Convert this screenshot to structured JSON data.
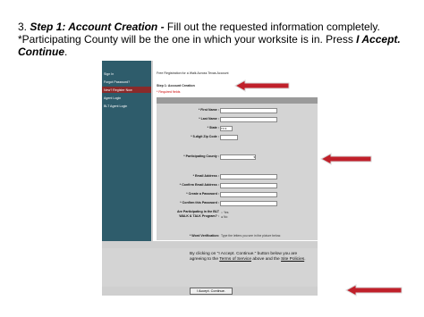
{
  "instruction": {
    "number": "3.",
    "step": "Step 1: Account Creation -",
    "text1": " Fill out the requested information completely. *Participating County will be the one in which your worksite is in.  Press ",
    "action": "I Accept. Continue",
    "end": "."
  },
  "sidebar": {
    "items": [
      "Sign In",
      "Forgot Password?",
      "New? Register Now",
      "Agent Login",
      "BLT Agent Login"
    ]
  },
  "form": {
    "page_title": "Free Registration for a Walk Across Texas Account",
    "step_title": "Step 1: Account Creation",
    "required_note": "* Required fields",
    "fields": {
      "first_name": "* First Name :",
      "last_name": "* Last Name :",
      "state": "* State :",
      "state_value": "TX",
      "zip": "* 5-digit Zip Code :",
      "county": "* Participating County :",
      "email": "* Email Address :",
      "confirm_email": "* Confirm Email Address :",
      "create_password": "* Create a Password :",
      "confirm_password": "* Confirm this Password :",
      "blt_question": "Are Participating in the BLT WALK & TALK Program? :",
      "yes": "Yes",
      "no": "No",
      "word_verification": "* Word Verification:",
      "verification_note": "Type the letters you see in the picture below."
    }
  },
  "agreement": {
    "text_a": "By clicking on \"I Accept. Continue.\" button below you are agreeing to the ",
    "terms": "Terms of Service",
    "text_b": " above and the ",
    "site_policies": "Site Policies",
    "text_c": "."
  },
  "accept_button": "I Accept. Continue.",
  "colors": {
    "sidebar": "#2e5c6b",
    "arrow": "#c0202a"
  }
}
